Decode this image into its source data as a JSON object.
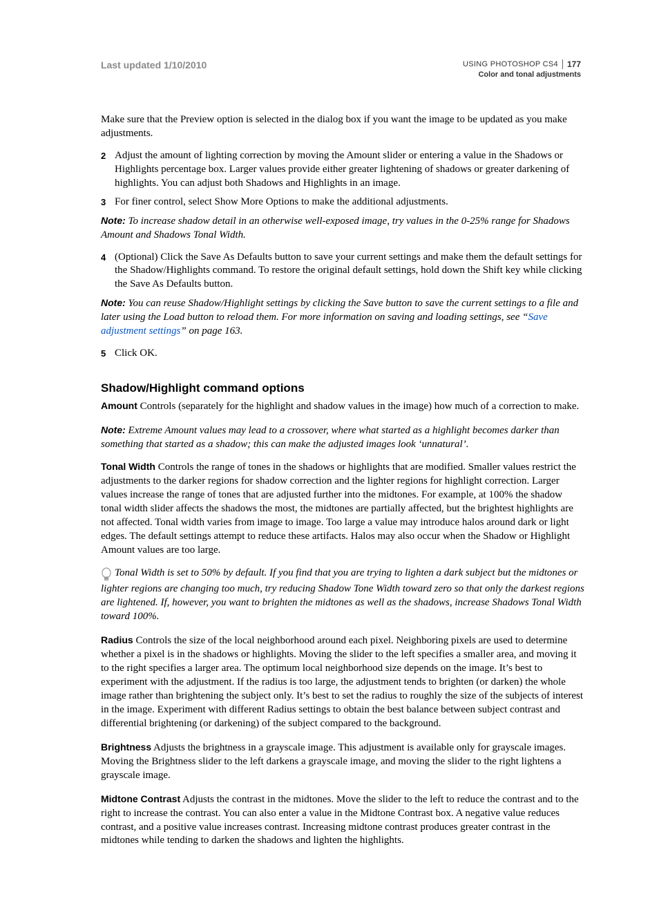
{
  "header": {
    "last_updated": "Last updated 1/10/2010",
    "using": "USING PHOTOSHOP CS4",
    "page_number": "177",
    "section": "Color and tonal adjustments"
  },
  "intro": "Make sure that the Preview option is selected in the dialog box if you want the image to be updated as you make adjustments.",
  "steps": {
    "s2_num": "2",
    "s2": "Adjust the amount of lighting correction by moving the Amount slider or entering a value in the Shadows or Highlights percentage box. Larger values provide either greater lightening of shadows or greater darkening of highlights. You can adjust both Shadows and Highlights in an image.",
    "s3_num": "3",
    "s3": "For finer control, select Show More Options to make the additional adjustments.",
    "s4_num": "4",
    "s4": "(Optional) Click the Save As Defaults button to save your current settings and make them the default settings for the Shadow/Highlights command. To restore the original default settings, hold down the Shift key while clicking the Save As Defaults button.",
    "s5_num": "5",
    "s5": "Click OK."
  },
  "notes": {
    "label": "Note:",
    "n1": " To increase shadow detail in an otherwise well-exposed image, try values in the 0-25% range for Shadows Amount and Shadows Tonal Width.",
    "n2a": " You can reuse Shadow/Highlight settings by clicking the Save button to save the current settings to a file and later using the Load button to reload them. For more information on saving and loading settings, see “",
    "n2link": "Save adjustment settings",
    "n2b": "” on page 163.",
    "n3": " Extreme Amount values may lead to a crossover, where what started as a highlight becomes darker than something that started as a shadow; this can make the adjusted images look ‘unnatural’."
  },
  "heading": "Shadow/Highlight command options",
  "defs": {
    "amount_term": "Amount",
    "amount": "  Controls (separately for the highlight and shadow values in the image) how much of a correction to make.",
    "tonal_term": "Tonal Width",
    "tonal": "  Controls the range of tones in the shadows or highlights that are modified. Smaller values restrict the adjustments to the darker regions for shadow correction and the lighter regions for highlight correction. Larger values increase the range of tones that are adjusted further into the midtones. For example, at 100% the shadow tonal width slider affects the shadows the most, the midtones are partially affected, but the brightest highlights are not affected. Tonal width varies from image to image. Too large a value may introduce halos around dark or light edges. The default settings attempt to reduce these artifacts. Halos may also occur when the Shadow or Highlight Amount values are too large.",
    "radius_term": "Radius",
    "radius": "  Controls the size of the local neighborhood around each pixel. Neighboring pixels are used to determine whether a pixel is in the shadows or highlights. Moving the slider to the left specifies a smaller area, and moving it to the right specifies a larger area. The optimum local neighborhood size depends on the image. It’s best to experiment with the adjustment. If the radius is too large, the adjustment tends to brighten (or darken) the whole image rather than brightening the subject only. It’s best to set the radius to roughly the size of the subjects of interest in the image. Experiment with different Radius settings to obtain the best balance between subject contrast and differential brightening (or darkening) of the subject compared to the background.",
    "brightness_term": "Brightness",
    "brightness": "  Adjusts the brightness in a grayscale image. This adjustment is available only for grayscale images. Moving the Brightness slider to the left darkens a grayscale image, and moving the slider to the right lightens a grayscale image.",
    "midtone_term": "Midtone Contrast",
    "midtone": "  Adjusts the contrast in the midtones. Move the slider to the left to reduce the contrast and to the right to increase the contrast. You can also enter a value in the Midtone Contrast box. A negative value reduces contrast, and a positive value increases contrast. Increasing midtone contrast produces greater contrast in the midtones while tending to darken the shadows and lighten the highlights."
  },
  "tip": "Tonal Width is set to 50% by default. If you find that you are trying to lighten a dark subject but the midtones or lighter regions are changing too much, try reducing Shadow Tone Width toward zero so that only the darkest regions are lightened. If, however, you want to brighten the midtones as well as the shadows, increase Shadows Tonal Width toward 100%."
}
